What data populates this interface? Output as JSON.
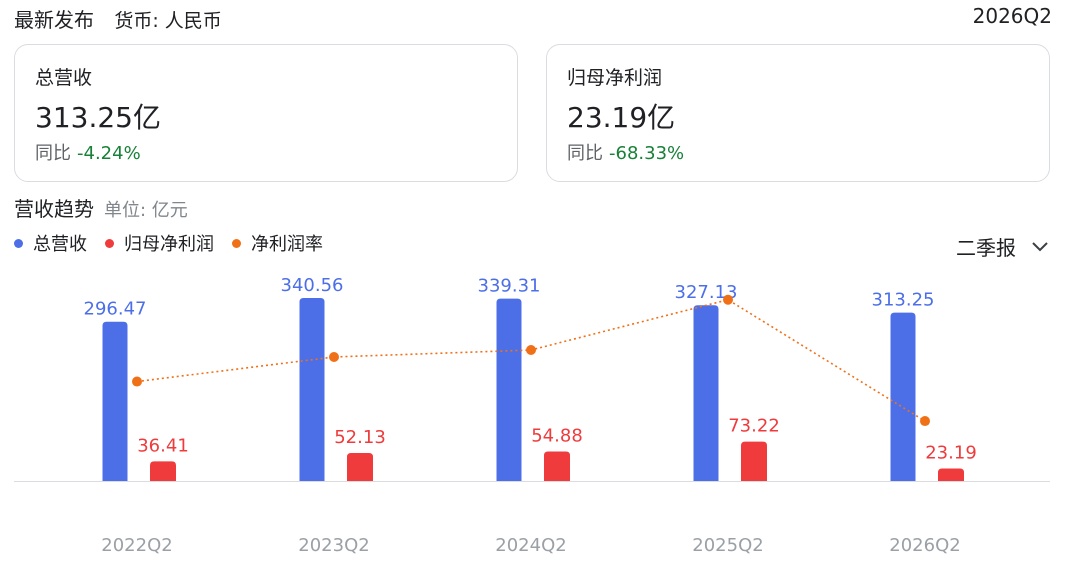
{
  "header": {
    "title": "最新发布",
    "currency": "货币: 人民币",
    "period": "2026Q2"
  },
  "cards": [
    {
      "title": "总营收",
      "value": "313.25亿",
      "yoy_label": "同比",
      "yoy_value": "-4.24%"
    },
    {
      "title": "归母净利润",
      "value": "23.19亿",
      "yoy_label": "同比",
      "yoy_value": "-68.33%"
    }
  ],
  "trend": {
    "title": "营收趋势",
    "unit": "单位: 亿元",
    "selector": "二季报"
  },
  "colors": {
    "revenue": "#4c6fe8",
    "profit": "#ef3b3b",
    "margin": "#f07018",
    "positive": "#188038"
  },
  "chart_data": {
    "type": "bar",
    "categories": [
      "2022Q2",
      "2023Q2",
      "2024Q2",
      "2025Q2",
      "2026Q2"
    ],
    "series": [
      {
        "name": "总营收",
        "values": [
          296.47,
          340.56,
          339.31,
          327.13,
          313.25
        ]
      },
      {
        "name": "归母净利润",
        "values": [
          36.41,
          52.13,
          54.88,
          73.22,
          23.19
        ]
      },
      {
        "name": "净利润率",
        "type": "line",
        "values": [
          12.28,
          15.31,
          16.17,
          22.38,
          7.4
        ]
      }
    ],
    "legend": "top-left",
    "grid": false
  }
}
